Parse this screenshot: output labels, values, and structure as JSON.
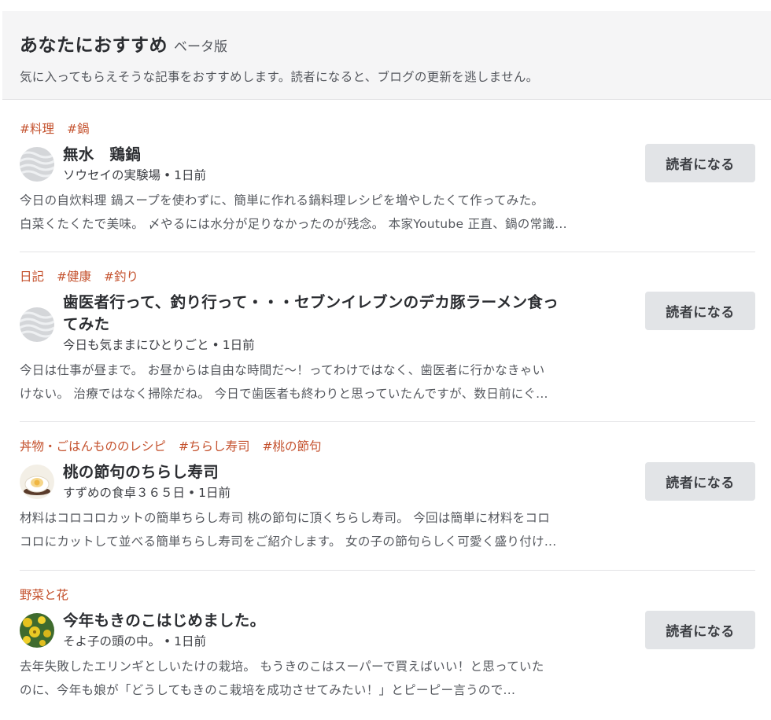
{
  "header": {
    "title": "あなたにおすすめ",
    "beta": "ベータ版",
    "subtitle": "気に入ってもらえそうな記事をおすすめします。読者になると、ブログの更新を逃しません。"
  },
  "entries": [
    {
      "tags": [
        "#料理",
        "#鍋"
      ],
      "title_lines": [
        "無水　鶏鍋"
      ],
      "blog": "ソウセイの実験場",
      "time": "1日前",
      "excerpt_lines": [
        "今日の自炊料理 鍋スープを使わずに、簡単に作れる鍋料理レシピを増やしたくて作ってみた。",
        "白菜くたくたで美味。 〆やるには水分が足りなかったのが残念。 本家Youtube 正直、鍋の常識..."
      ],
      "button_label": "読者になる",
      "avatar_icon": "default-blog-icon"
    },
    {
      "tags": [
        "日記",
        "#健康",
        "#釣り"
      ],
      "title_lines": [
        "歯医者行って、釣り行って・・・セブンイレブンのデカ豚ラーメン食っ",
        "てみた"
      ],
      "blog": "今日も気ままにひとりごと",
      "time": "1日前",
      "excerpt_lines": [
        "今日は仕事が昼まで。 お昼からは自由な時間だ～！ってわけではなく、歯医者に行かなきゃい",
        "けない。 治療ではなく掃除だね。 今日で歯医者も終わりと思っていたんですが、数日前にぐ..."
      ],
      "button_label": "読者になる",
      "avatar_icon": "default-blog-icon"
    },
    {
      "tags": [
        "丼物・ごはんもののレシピ",
        "#ちらし寿司",
        "#桃の節句"
      ],
      "title_lines": [
        "桃の節句のちらし寿司"
      ],
      "blog": "すずめの食卓３６５日",
      "time": "1日前",
      "excerpt_lines": [
        "材料はコロコロカットの簡単ちらし寿司 桃の節句に頂くちらし寿司。 今回は簡単に材料をコロ",
        "コロにカットして並べる簡単ちらし寿司をご紹介します。 女の子の節句らしく可愛く盛り付け..."
      ],
      "button_label": "読者になる",
      "avatar_icon": "egg-bowl-icon"
    },
    {
      "tags": [
        "野菜と花"
      ],
      "title_lines": [
        "今年もきのこはじめました。"
      ],
      "blog": "そよ子の頭の中。",
      "time": "1日前",
      "excerpt_lines": [
        "去年失敗したエリンギとしいたけの栽培。 もうきのこはスーパーで買えばいい！と思っていた",
        "のに、今年も娘が「どうしてもきのこ栽培を成功させてみたい！」とピーピー言うので..."
      ],
      "button_label": "読者になる",
      "avatar_icon": "yellow-flowers-icon"
    }
  ]
}
